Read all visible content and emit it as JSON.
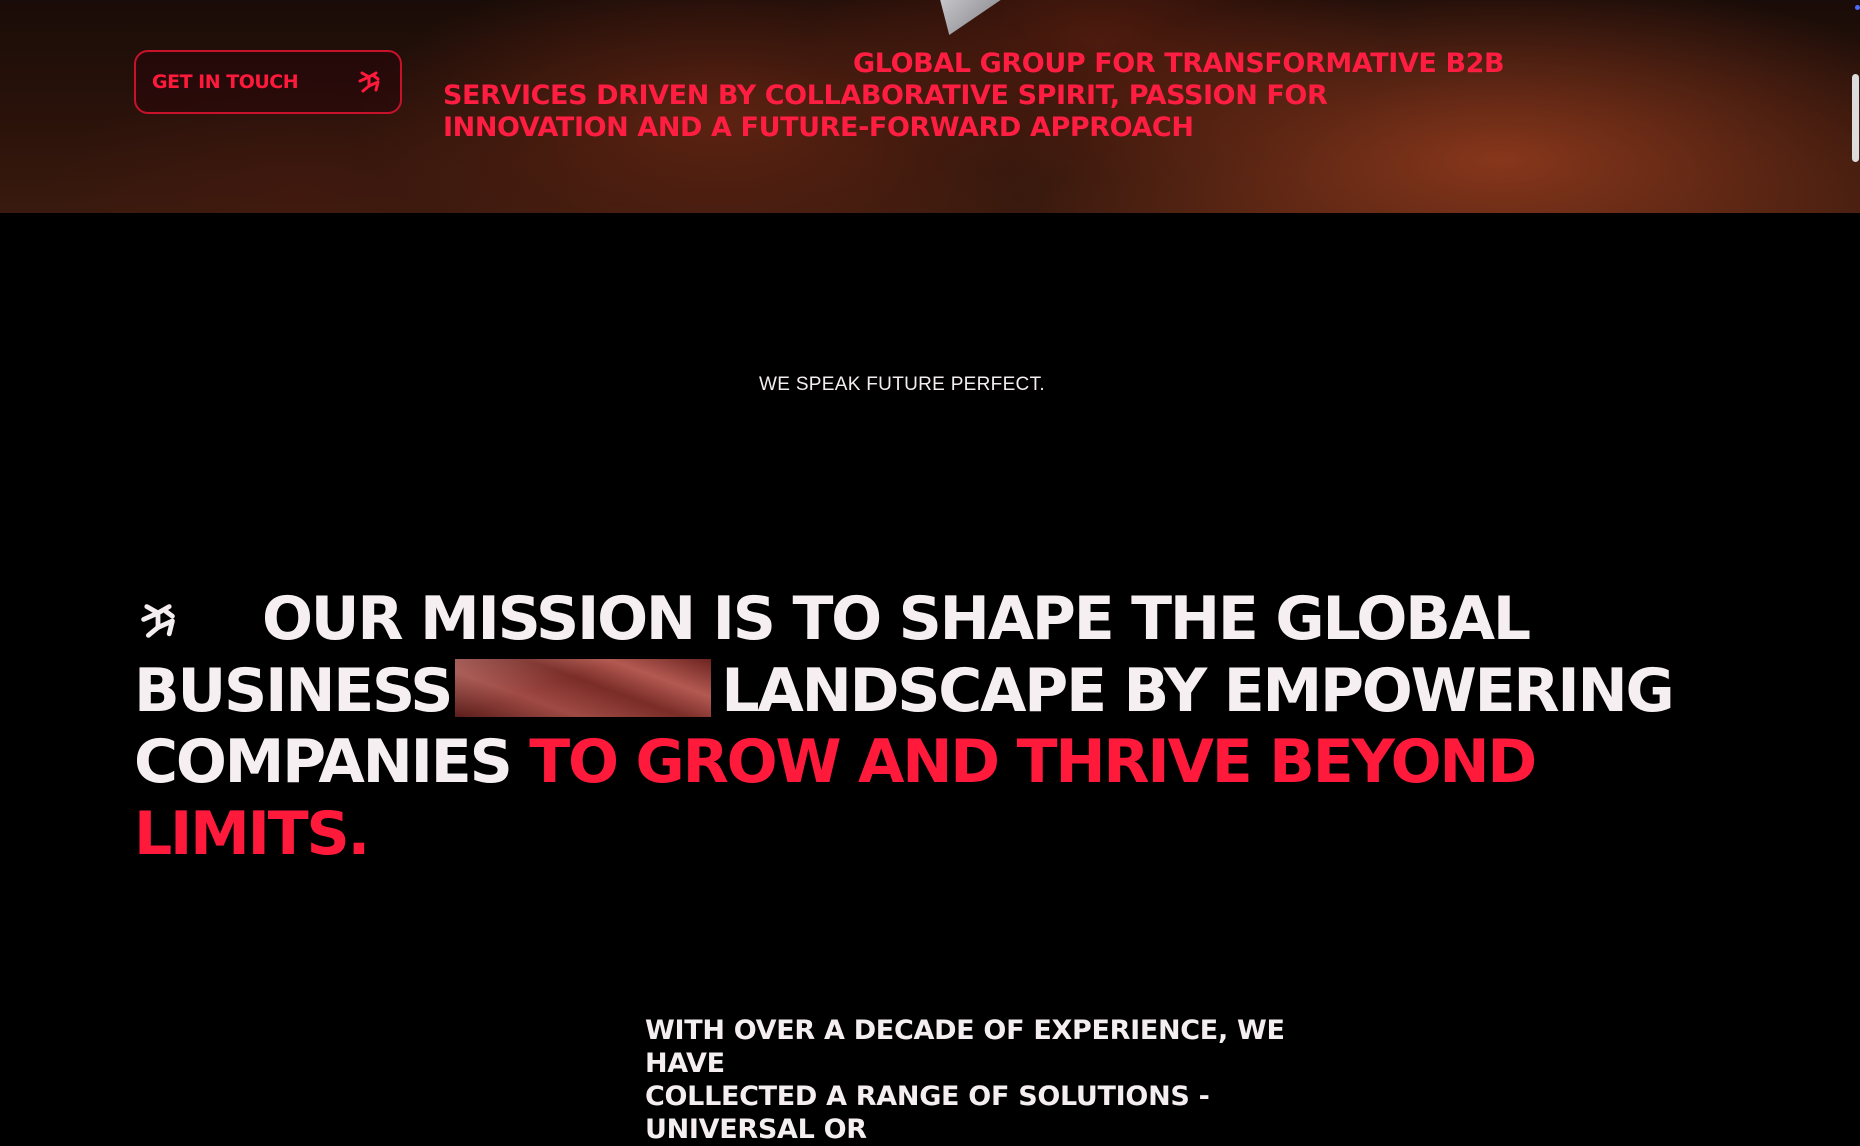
{
  "hero": {
    "cta_label": "GET IN TOUCH",
    "cta_icon": "brand-mark-icon",
    "lines": [
      "GLOBAL GROUP FOR TRANSFORMATIVE B2B",
      "SERVICES DRIVEN BY COLLABORATIVE SPIRIT, PASSION FOR",
      "INNOVATION AND A FUTURE-FORWARD APPROACH"
    ]
  },
  "tagline": "WE SPEAK FUTURE PERFECT.",
  "mission": {
    "icon": "brand-mark-icon",
    "line1": "OUR MISSION IS TO SHAPE THE GLOBAL",
    "line2a": "BUSINESS",
    "line2b": "LANDSCAPE BY EMPOWERING",
    "line3a": "COMPANIES",
    "accent1": "TO GROW AND THRIVE BEYOND",
    "accent2": "LIMITS."
  },
  "experience": {
    "line1": "WITH OVER A DECADE OF EXPERIENCE, WE HAVE",
    "line2": "COLLECTED A RANGE OF SOLUTIONS - UNIVERSAL OR"
  },
  "colors": {
    "accent": "#ff1a3c",
    "background": "#000000",
    "text": "#f4eef0"
  }
}
